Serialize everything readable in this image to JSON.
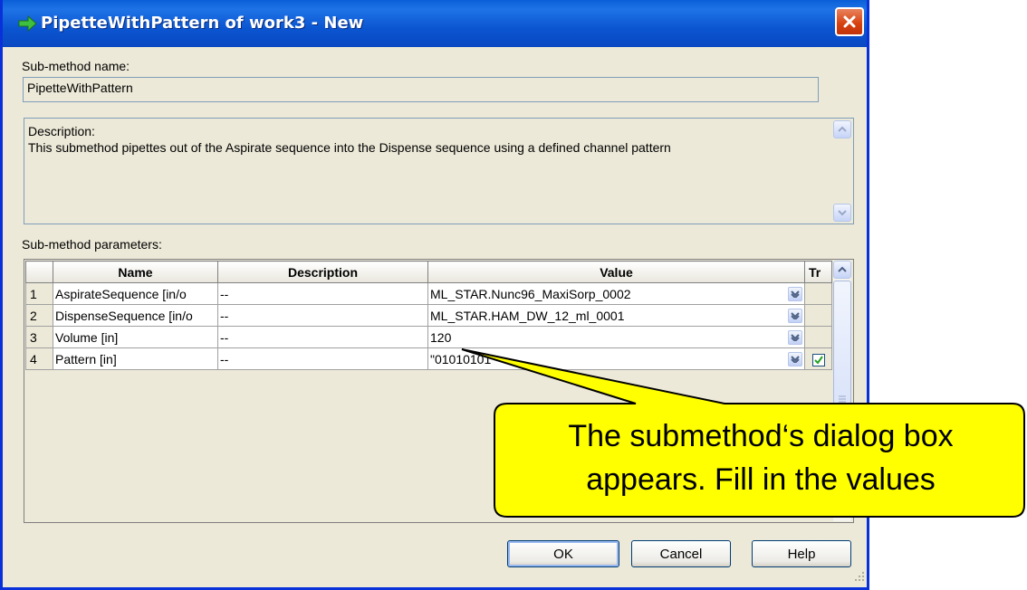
{
  "window": {
    "title": "PipetteWithPattern of work3 - New",
    "icon": "green-arrow-icon",
    "close_icon": "close-icon",
    "title_color": "#0a5fd8",
    "close_color": "#d6400c"
  },
  "submethod_name": {
    "label": "Sub-method name:",
    "value": "PipetteWithPattern"
  },
  "description": {
    "caption": "Description:",
    "text": "This submethod pipettes out of the Aspirate sequence into the Dispense sequence using a defined channel pattern"
  },
  "parameters": {
    "label": "Sub-method parameters:",
    "columns": {
      "name": "Name",
      "description": "Description",
      "value": "Value",
      "tr": "Tr"
    },
    "rows": [
      {
        "num": "1",
        "name": "AspirateSequence [in/o",
        "description": "--",
        "value": "ML_STAR.Nunc96_MaxiSorp_0002",
        "tr_checked": false
      },
      {
        "num": "2",
        "name": "DispenseSequence [in/o",
        "description": "--",
        "value": "ML_STAR.HAM_DW_12_ml_0001",
        "tr_checked": false
      },
      {
        "num": "3",
        "name": "Volume [in]",
        "description": "--",
        "value": "120",
        "tr_checked": false
      },
      {
        "num": "4",
        "name": "Pattern [in]",
        "description": "--",
        "value": "\"01010101",
        "tr_checked": true
      }
    ]
  },
  "buttons": {
    "ok": "OK",
    "cancel": "Cancel",
    "help": "Help"
  },
  "callout": {
    "line1": "The submethod‘s dialog box",
    "line2": "appears. Fill in the values",
    "fill_color": "#ffff00"
  }
}
